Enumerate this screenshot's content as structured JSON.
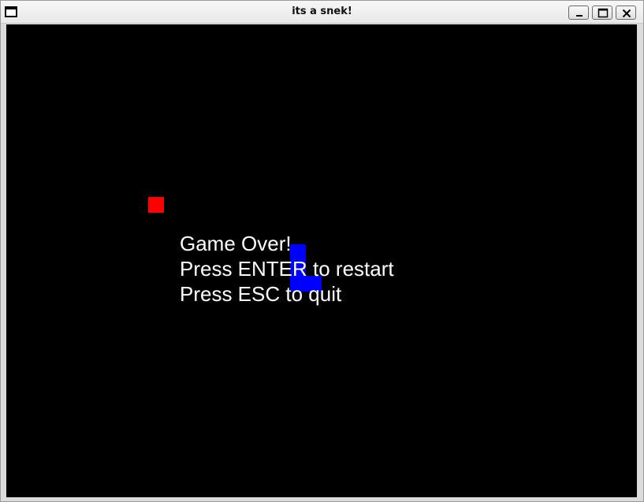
{
  "window": {
    "title": "its a snek!",
    "buttons": [
      "minimize",
      "maximize",
      "close"
    ]
  },
  "game": {
    "state": "game_over",
    "messages": {
      "line1": "Game Over!",
      "line2": "Press ENTER to restart",
      "line3": "Press ESC to quit"
    },
    "colors": {
      "background": "#000000",
      "food": "#ff0000",
      "snake": "#0000ff",
      "text": "#ffffff"
    }
  }
}
